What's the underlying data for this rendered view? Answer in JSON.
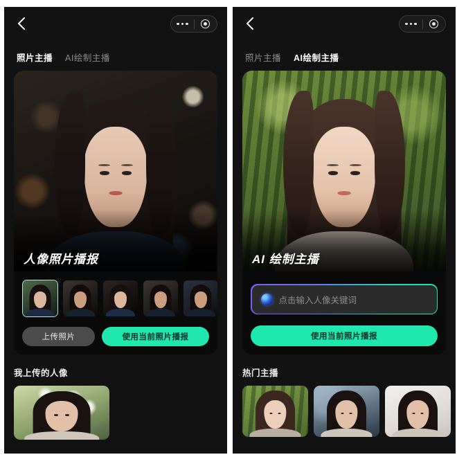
{
  "panels": [
    {
      "nav": {
        "back_icon": "chevron-left-icon",
        "capsule": {
          "more_icon": "more-dots-icon",
          "target_icon": "circle-target-icon"
        }
      },
      "tabs": [
        {
          "label": "照片主播",
          "active": true
        },
        {
          "label": "AI绘制主播",
          "active": false
        }
      ],
      "hero": {
        "title": "人像照片播报",
        "scene": "indoor-bokeh-portrait"
      },
      "thumbnails": [
        {
          "name": "preset-female-1",
          "selected": true
        },
        {
          "name": "preset-male-1",
          "selected": false
        },
        {
          "name": "preset-female-2",
          "selected": false
        },
        {
          "name": "preset-male-2",
          "selected": false
        },
        {
          "name": "preset-male-3",
          "selected": false
        }
      ],
      "buttons": {
        "secondary_label": "上传照片",
        "primary_label": "使用当前照片播报"
      },
      "section": {
        "title": "我上传的人像",
        "cards": [
          {
            "name": "uploaded-portrait-1",
            "scene": "flower"
          }
        ]
      }
    },
    {
      "nav": {
        "back_icon": "chevron-left-icon",
        "capsule": {
          "more_icon": "more-dots-icon",
          "target_icon": "circle-target-icon"
        }
      },
      "tabs": [
        {
          "label": "照片主播",
          "active": false
        },
        {
          "label": "AI绘制主播",
          "active": true
        }
      ],
      "hero": {
        "title": "AI 绘制主播",
        "scene": "bamboo-forest-portrait"
      },
      "prompt": {
        "icon": "ai-orb-icon",
        "placeholder": "点击输入人像关键词",
        "value": ""
      },
      "buttons": {
        "primary_label": "使用当前照片播报"
      },
      "section": {
        "title": "热门主播",
        "cards": [
          {
            "name": "hot-anchor-1",
            "scene": "bamboo"
          },
          {
            "name": "hot-anchor-2",
            "scene": "street"
          },
          {
            "name": "hot-anchor-3",
            "scene": "studio"
          }
        ]
      }
    }
  ],
  "colors": {
    "accent_green": "#1fe7ad",
    "panel_bg": "#121212",
    "card_bg": "#0a0a0a",
    "secondary_btn": "#4b4b4b",
    "tab_inactive": "#8a8a8a",
    "gradient_border_start": "#7b5cf0",
    "gradient_border_end": "#1fe7ad"
  }
}
